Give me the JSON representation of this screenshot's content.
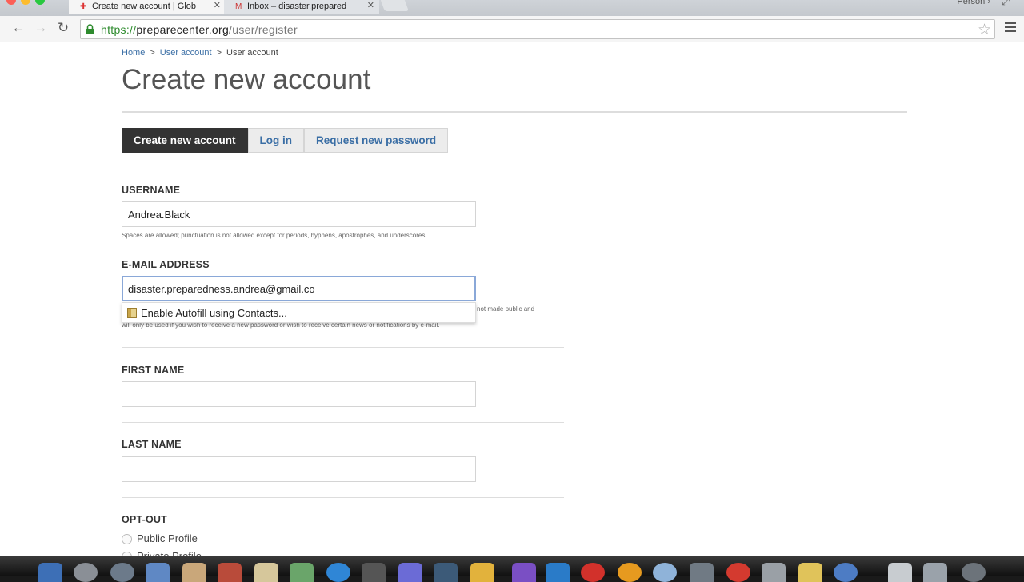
{
  "browser": {
    "tabs": [
      {
        "title": "Create new account | Glob",
        "favicon": "cross-icon",
        "active": true
      },
      {
        "title": "Inbox – disaster.prepared",
        "favicon": "gmail-icon",
        "active": false
      }
    ],
    "profile": "Person",
    "url": {
      "scheme": "https://",
      "host": "preparecenter.org",
      "path": "/user/register"
    }
  },
  "breadcrumb": [
    {
      "label": "Home",
      "link": true
    },
    {
      "label": "User account",
      "link": true
    },
    {
      "label": "User account",
      "link": false
    }
  ],
  "breadcrumb_sep": ">",
  "page_title": "Create new account",
  "tabs": [
    {
      "label": "Create new account",
      "active": true
    },
    {
      "label": "Log in",
      "active": false
    },
    {
      "label": "Request new password",
      "active": false
    }
  ],
  "form": {
    "username": {
      "label": "USERNAME",
      "value": "Andrea.Black",
      "help": "Spaces are allowed; punctuation is not allowed except for periods, hyphens, apostrophes, and underscores."
    },
    "email": {
      "label": "E-MAIL ADDRESS",
      "value": "disaster.preparedness.andrea@gmail.co",
      "help_right": "not made public and",
      "help_line2": "will only be used if you wish to receive a new password or wish to receive certain news or notifications by e-mail."
    },
    "autofill": "Enable Autofill using Contacts...",
    "first_name": {
      "label": "FIRST NAME",
      "value": ""
    },
    "last_name": {
      "label": "LAST NAME",
      "value": ""
    },
    "opt_out": {
      "label": "OPT-OUT",
      "options": [
        "Public Profile",
        "Private Profile"
      ]
    }
  },
  "colors": {
    "link": "#3a6ea5",
    "active_tab": "#333333",
    "secure_scheme": "#2e8b2e"
  }
}
